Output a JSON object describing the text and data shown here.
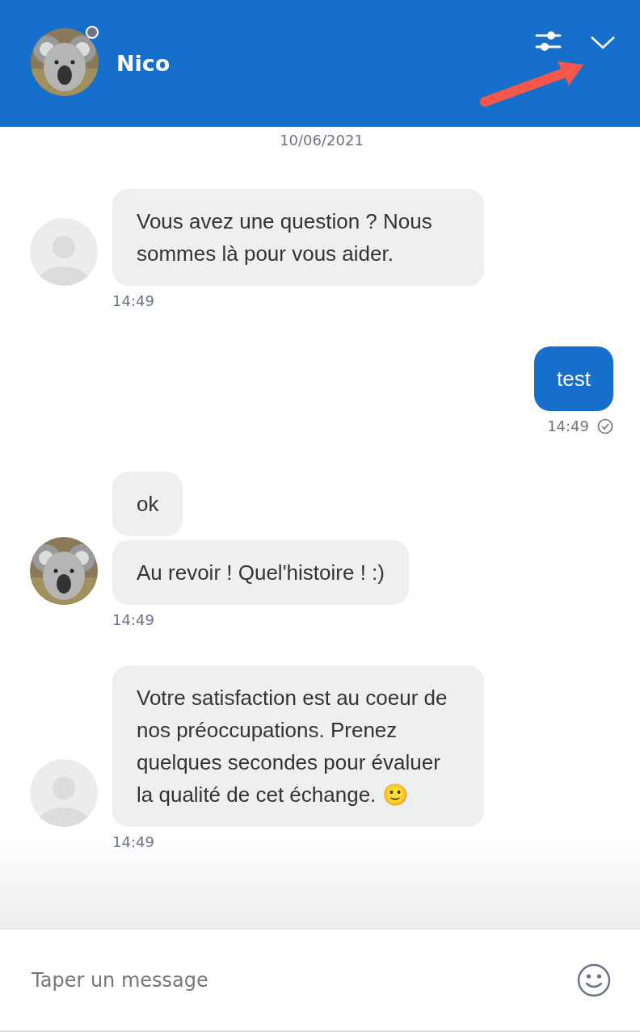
{
  "header": {
    "contact_name": "Nico",
    "online": false
  },
  "date": "10/06/2021",
  "groups": [
    {
      "kind": "incoming",
      "avatar": {
        "kind": "placeholder"
      },
      "bubbles": [
        "Vous avez une question ? Nous sommes là pour vous aider."
      ],
      "time": "14:49"
    },
    {
      "kind": "outgoing",
      "bubbles": [
        "test"
      ],
      "time": "14:49",
      "delivered": true
    },
    {
      "kind": "incoming",
      "bubbles": [
        "ok",
        "Au revoir ! Quel'histoire ! :)"
      ],
      "time": "14:49"
    },
    {
      "kind": "incoming",
      "avatar": {
        "kind": "placeholder"
      },
      "bubbles": [
        "Votre satisfaction est au coeur de nos préoccupations. Prenez quelques secondes pour évaluer la qualité de cet échange. 🙂"
      ],
      "time": "14:49"
    }
  ],
  "composer": {
    "placeholder": "Taper un message"
  }
}
